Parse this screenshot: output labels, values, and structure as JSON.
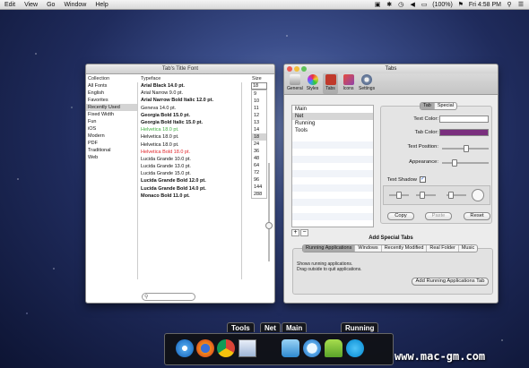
{
  "menubar": {
    "items": [
      "Edit",
      "View",
      "Go",
      "Window",
      "Help"
    ],
    "battery": "(100%)",
    "clock": "Fri 4:58 PM"
  },
  "font_window": {
    "title": "Tab's Title Font",
    "headers": {
      "collection": "Collection",
      "typeface": "Typeface",
      "size": "Size"
    },
    "collections": [
      "All Fonts",
      "English",
      "Favorites",
      "Recently Used",
      "Fixed Width",
      "Fun",
      "iOS",
      "Modern",
      "PDF",
      "Traditional",
      "Web"
    ],
    "selected_collection": 3,
    "typefaces": [
      {
        "text": "Arial Black 14.0 pt.",
        "color": "#111",
        "bold": true
      },
      {
        "text": "Arial Narrow 9.0 pt.",
        "color": "#111",
        "bold": false
      },
      {
        "text": "Arial Narrow Bold Italic 12.0 pt.",
        "color": "#111",
        "bold": true
      },
      {
        "text": "Geneva 14.0 pt.",
        "color": "#111",
        "bold": false
      },
      {
        "text": "Georgia Bold 15.0 pt.",
        "color": "#111",
        "bold": true
      },
      {
        "text": "Georgia Bold Italic 15.0 pt.",
        "color": "#111",
        "bold": true
      },
      {
        "text": "Helvetica 18.0 pt.",
        "color": "#3fae3f",
        "bold": false
      },
      {
        "text": "Helvetica 18.0 pt.",
        "color": "#111",
        "bold": false
      },
      {
        "text": "Helvetica 18.0 pt.",
        "color": "#111",
        "bold": false
      },
      {
        "text": "Helvetica Bold 18.0 pt.",
        "color": "#e0252a",
        "bold": false
      },
      {
        "text": "Lucida Grande 10.0 pt.",
        "color": "#111",
        "bold": false
      },
      {
        "text": "Lucida Grande 13.0 pt.",
        "color": "#111",
        "bold": false
      },
      {
        "text": "Lucida Grande 15.0 pt.",
        "color": "#111",
        "bold": false
      },
      {
        "text": "Lucida Grande Bold 12.0 pt.",
        "color": "#111",
        "bold": true
      },
      {
        "text": "Lucida Grande Bold 14.0 pt.",
        "color": "#111",
        "bold": true
      },
      {
        "text": "Monaco Bold 11.0 pt.",
        "color": "#111",
        "bold": true
      }
    ],
    "size_value": "18",
    "sizes": [
      "9",
      "10",
      "11",
      "12",
      "13",
      "14",
      "18",
      "24",
      "36",
      "48",
      "64",
      "72",
      "96",
      "144",
      "288"
    ],
    "selected_size": 6
  },
  "tabs_window": {
    "title": "Tabs",
    "toolbar": [
      "General",
      "Styles",
      "Tabs",
      "Icons",
      "Settings"
    ],
    "toolbar_active": 2,
    "tab_list": [
      "Main",
      "Net",
      "Running",
      "Tools"
    ],
    "selected_tab": 1,
    "segment": [
      "Tab",
      "Special"
    ],
    "tab_text_color_label": "Text Color:",
    "tab_color_label": "Tab Color:",
    "tab_color": "#7a2f7e",
    "text_position_label": "Text Position:",
    "appearance_label": "Appearance:",
    "text_shadow_label": "Text Shadow",
    "buttons": {
      "copy": "Copy",
      "paste": "Paste",
      "reset": "Reset"
    },
    "add_special_tabs_title": "Add Special Tabs",
    "special_tabs": [
      "Running Applications",
      "Windows",
      "Recently Modified",
      "Real Folder",
      "Music"
    ],
    "special_selected": 0,
    "description": [
      "Shows running applications.",
      "Drag outside to quit applications."
    ],
    "add_button": "Add Running Applications Tab",
    "plus": "+",
    "minus": "−"
  },
  "dock": {
    "tabs": [
      "Tools",
      "Net",
      "Main",
      "Running"
    ],
    "icons": [
      "safari-icon",
      "firefox-icon",
      "chrome-icon",
      "preview-icon",
      "facetime-icon",
      "messages-icon",
      "android-icon",
      "skype-icon"
    ]
  },
  "watermark": "www.mac-gm.com"
}
